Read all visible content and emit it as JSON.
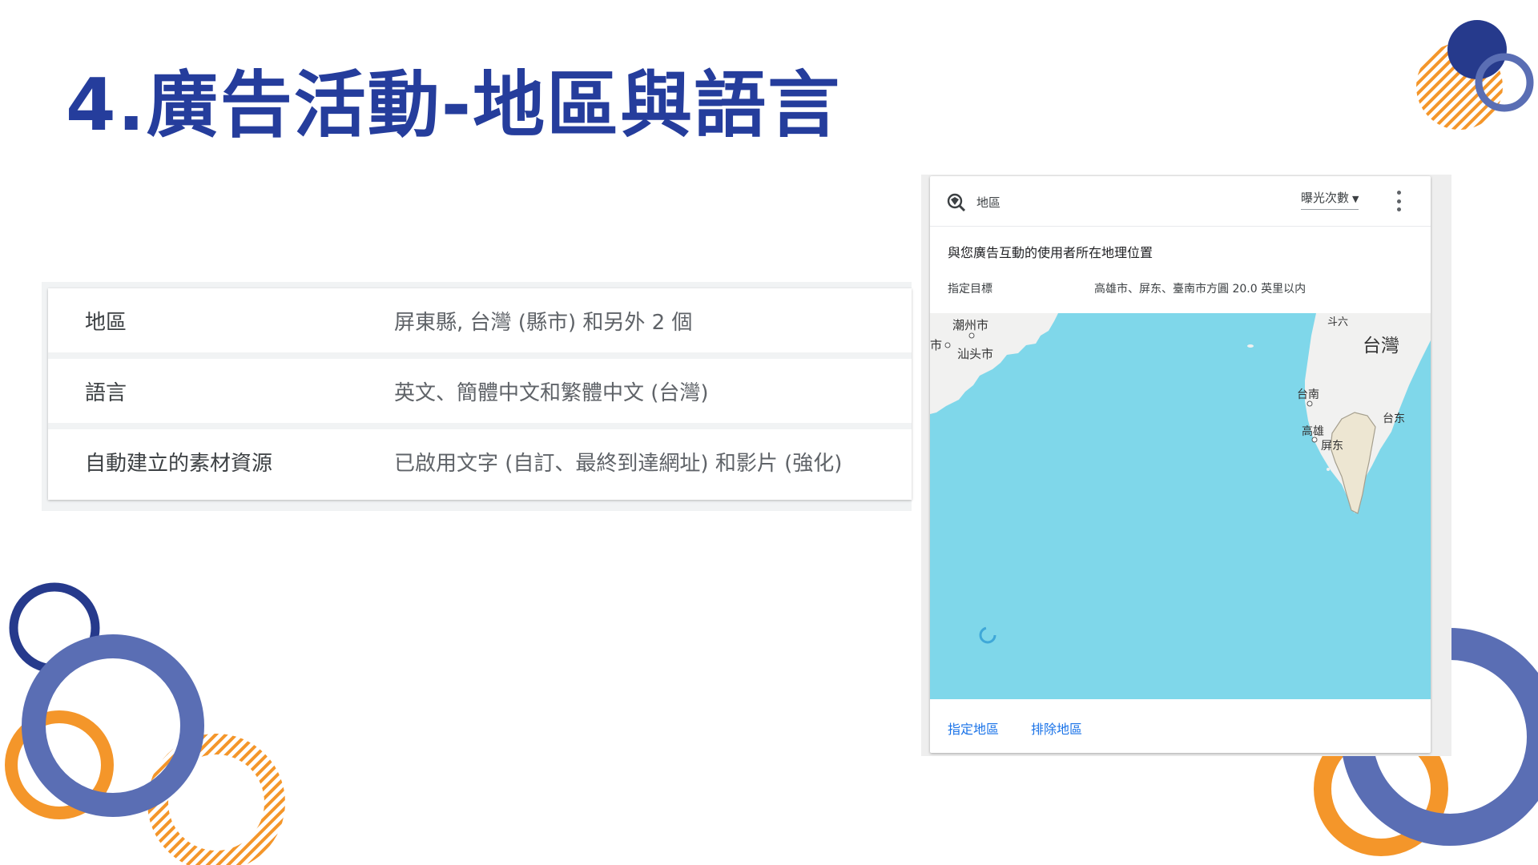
{
  "slide": {
    "title": "4.廣告活動-地區與語言"
  },
  "settings": {
    "rows": [
      {
        "label": "地區",
        "value": "屏東縣, 台灣 (縣市) 和另外 2 個"
      },
      {
        "label": "語言",
        "value": "英文、簡體中文和繁體中文 (台灣)"
      },
      {
        "label": "自動建立的素材資源",
        "value": "已啟用文字 (自訂、最終到達網址) 和影片 (強化)"
      }
    ]
  },
  "map_card": {
    "title": "地區",
    "metric_select": "曝光次數",
    "subtitle": "與您廣告互動的使用者所在地理位置",
    "target_label": "指定目標",
    "target_value": "高雄市、屏东、臺南市方圓 20.0 英里以内",
    "map_labels": {
      "chaozhou": "潮州市",
      "shantou": "汕头市",
      "city_edge": "市",
      "douliu": "斗六",
      "taiwan": "台灣",
      "tainan": "台南",
      "taitung": "台东",
      "kaohsiung": "高雄",
      "pingtung": "屏东"
    },
    "footer": {
      "targeted_link": "指定地區",
      "excluded_link": "排除地區"
    },
    "colors": {
      "sea": "#7fd7ea",
      "land": "#f1f1f0",
      "highlight_region": "#ede6d2",
      "link": "#1a73e8"
    }
  },
  "decoration_colors": {
    "navy": "#263a8c",
    "periwinkle": "#5a6eb4",
    "orange": "#f4962a"
  }
}
